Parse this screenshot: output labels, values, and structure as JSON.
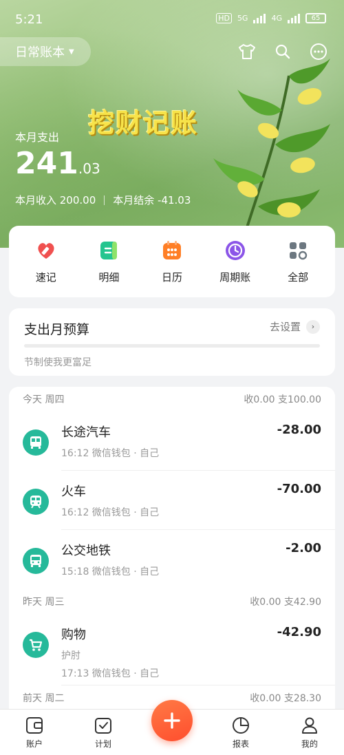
{
  "status_bar": {
    "time": "5:21",
    "hd": "HD",
    "net1": "5G",
    "net2": "4G",
    "battery": "65"
  },
  "header": {
    "book_name": "日常账本",
    "brand_text": "挖财记账",
    "expense_label": "本月支出",
    "expense_int": "241",
    "expense_dec": ".03",
    "income_text": "本月收入 200.00",
    "balance_text": "本月结余  -41.03"
  },
  "quick_actions": [
    {
      "label": "速记",
      "icon": "heart-pencil-icon",
      "color": "#f0504f"
    },
    {
      "label": "明细",
      "icon": "detail-list-icon",
      "color": "#25c58f"
    },
    {
      "label": "日历",
      "icon": "calendar-icon",
      "color": "#ff7f26"
    },
    {
      "label": "周期账",
      "icon": "clock-cycle-icon",
      "color": "#8b55e8"
    },
    {
      "label": "全部",
      "icon": "grid-apps-icon",
      "color": "#6c7780"
    }
  ],
  "budget": {
    "title": "支出月预算",
    "action": "去设置",
    "tip": "节制使我更富足"
  },
  "days": [
    {
      "label": "今天 周四",
      "summary": "收0.00 支100.00",
      "items": [
        {
          "name": "长途汽车",
          "meta": "16:12 微信钱包 · 自己",
          "amount": "-28.00",
          "icon": "bus-icon"
        },
        {
          "name": "火车",
          "meta": "16:12 微信钱包 · 自己",
          "amount": "-70.00",
          "icon": "train-icon"
        },
        {
          "name": "公交地铁",
          "meta": "15:18 微信钱包 · 自己",
          "amount": "-2.00",
          "icon": "bus-icon"
        }
      ]
    },
    {
      "label": "昨天 周三",
      "summary": "收0.00 支42.90",
      "items": [
        {
          "name": "购物",
          "note": "护肘",
          "meta": "17:13 微信钱包 · 自己",
          "amount": "-42.90",
          "icon": "cart-icon"
        }
      ]
    },
    {
      "label": "前天 周二",
      "summary": "收0.00 支28.30"
    }
  ],
  "bottom_nav": {
    "accounts": "账户",
    "plan": "计划",
    "reports": "报表",
    "mine": "我的"
  },
  "colors": {
    "accent": "#26b99a",
    "fab": "#ff5a33",
    "brand_yellow": "#f7e34a"
  }
}
